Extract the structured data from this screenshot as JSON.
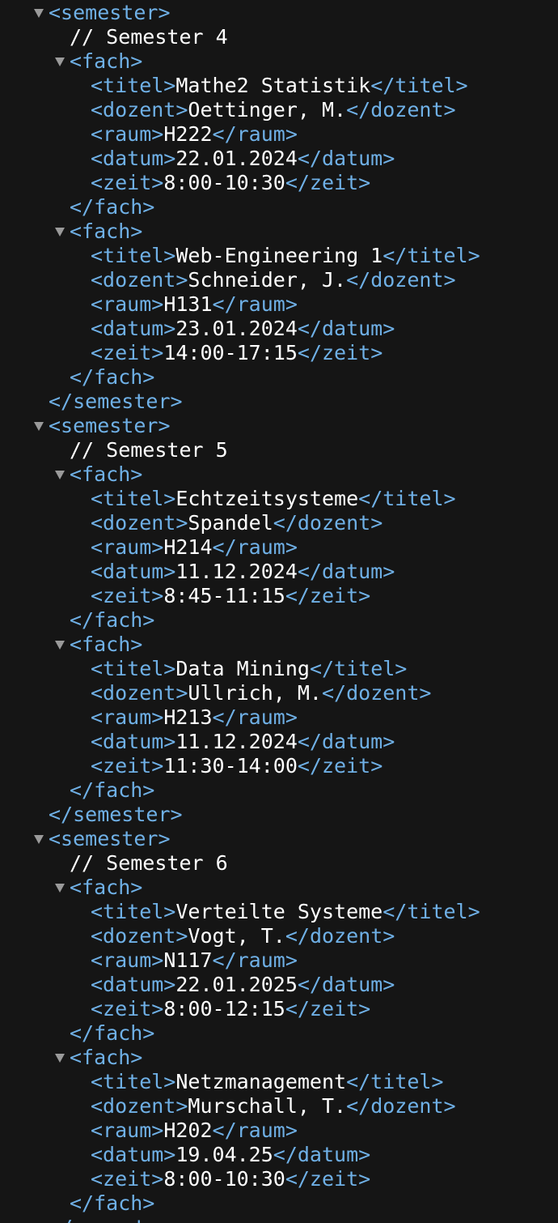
{
  "colors": {
    "background": "#151515",
    "tag": "#6fb0e6",
    "text": "#ffffff",
    "caret": "#9a9a9a"
  },
  "icons": {
    "expanded": "triangle-down-icon"
  },
  "semester_tag": "semester",
  "fach_tag": "fach",
  "semesters": [
    {
      "comment": "// Semester 4",
      "faecher": [
        {
          "titel": "Mathe2 Statistik",
          "dozent": "Oettinger, M.",
          "raum": "H222",
          "datum": "22.01.2024",
          "zeit": "8:00-10:30"
        },
        {
          "titel": "Web-Engineering 1",
          "dozent": "Schneider, J.",
          "raum": "H131",
          "datum": "23.01.2024",
          "zeit": "14:00-17:15"
        }
      ]
    },
    {
      "comment": "// Semester 5",
      "faecher": [
        {
          "titel": "Echtzeitsysteme",
          "dozent": "Spandel",
          "raum": "H214",
          "datum": "11.12.2024",
          "zeit": "8:45-11:15"
        },
        {
          "titel": "Data Mining",
          "dozent": "Ullrich, M.",
          "raum": "H213",
          "datum": "11.12.2024",
          "zeit": "11:30-14:00"
        }
      ]
    },
    {
      "comment": "// Semester 6",
      "faecher": [
        {
          "titel": "Verteilte Systeme",
          "dozent": "Vogt, T.",
          "raum": "N117",
          "datum": "22.01.2025",
          "zeit": "8:00-12:15"
        },
        {
          "titel": "Netzmanagement",
          "dozent": "Murschall, T.",
          "raum": "H202",
          "datum": "19.04.25",
          "zeit": "8:00-10:30"
        }
      ]
    }
  ]
}
